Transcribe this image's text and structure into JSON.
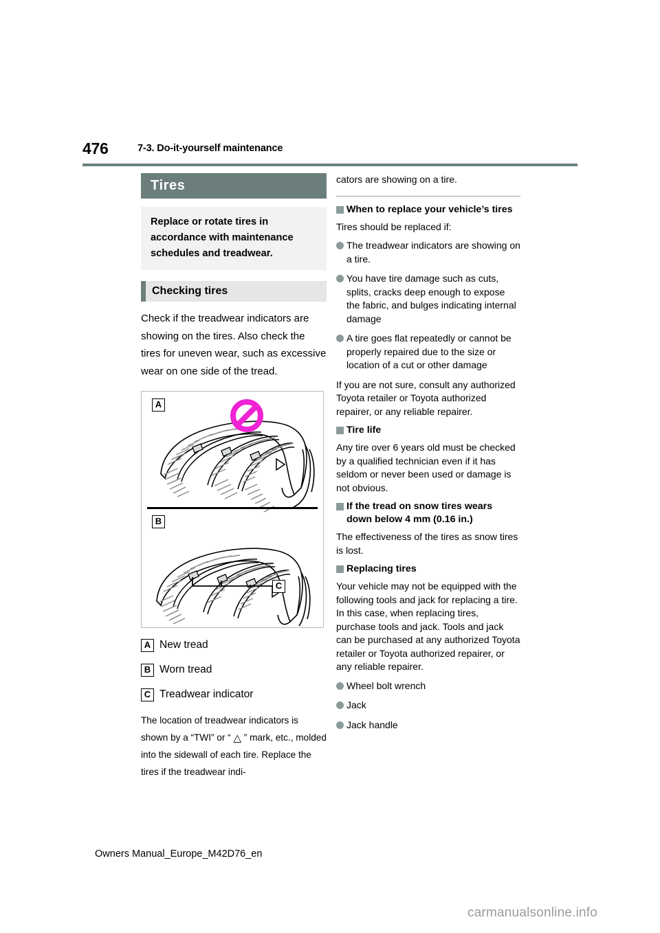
{
  "header": {
    "page_number": "476",
    "section_title": "7-3. Do-it-yourself maintenance"
  },
  "left_column": {
    "banner_title": "Tires",
    "callout": "Replace or rotate tires in accordance with maintenance schedules and treadwear.",
    "sub_banner_title": "Checking tires",
    "intro_paragraph": "Check if the treadwear indicators are showing on the tires. Also check the tires for uneven wear, such as excessive wear on one side of the tread.",
    "illustration": {
      "panel_a_tag": "A",
      "panel_b_tag": "B",
      "callout_c_tag": "C",
      "prohibition_icon": "no-entry-icon"
    },
    "legend": [
      {
        "tag": "A",
        "label": "New tread"
      },
      {
        "tag": "B",
        "label": "Worn tread"
      },
      {
        "tag": "C",
        "label": "Treadwear indicator"
      }
    ],
    "closing_paragraph_part1": "The location of treadwear indicators is shown by a “TWI” or “ ",
    "closing_triangle": "△",
    "closing_paragraph_part2": " ” mark, etc., molded into the sidewall of each tire. Replace the tires if the treadwear indi-"
  },
  "right_column": {
    "continued_text": "cators are showing on a tire.",
    "sections": [
      {
        "heading": "When to replace your vehicle’s tires",
        "intro": "Tires should be replaced if:",
        "bullets": [
          "The treadwear indicators are showing on a tire.",
          "You have tire damage such as cuts, splits, cracks deep enough to expose the fabric, and bulges indicating internal damage",
          "A tire goes flat repeatedly or cannot be properly repaired due to the size or location of a cut or other damage"
        ],
        "outro": "If you are not sure, consult any authorized Toyota retailer or Toyota authorized repairer, or any reliable repairer."
      },
      {
        "heading": "Tire life",
        "body": "Any tire over 6 years old must be checked by a qualified technician even if it has seldom or never been used or damage is not obvious."
      },
      {
        "heading": "If the tread on snow tires wears down below 4 mm (0.16 in.)",
        "body": "The effectiveness of the tires as snow tires is lost."
      },
      {
        "heading": "Replacing tires",
        "body": "Your vehicle may not be equipped with the following tools and jack for replacing a tire. In this case, when replacing tires, purchase tools and jack. Tools and jack can be purchased at any authorized Toyota retailer or Toyota authorized repairer, or any reliable repairer.",
        "bullets": [
          "Wheel bolt wrench",
          "Jack",
          "Jack handle"
        ]
      }
    ]
  },
  "footer": {
    "file_label": "Owners Manual_Europe_M42D76_en",
    "watermark": "carmanualsonline.info"
  },
  "colors": {
    "banner": "#6b7e7c",
    "rule": "#67807e",
    "callout_bg": "#f2f2f2",
    "sub_banner_bg": "#e4e7e6",
    "bullet": "#8a9b99",
    "prohibition": "#ef23d4"
  }
}
